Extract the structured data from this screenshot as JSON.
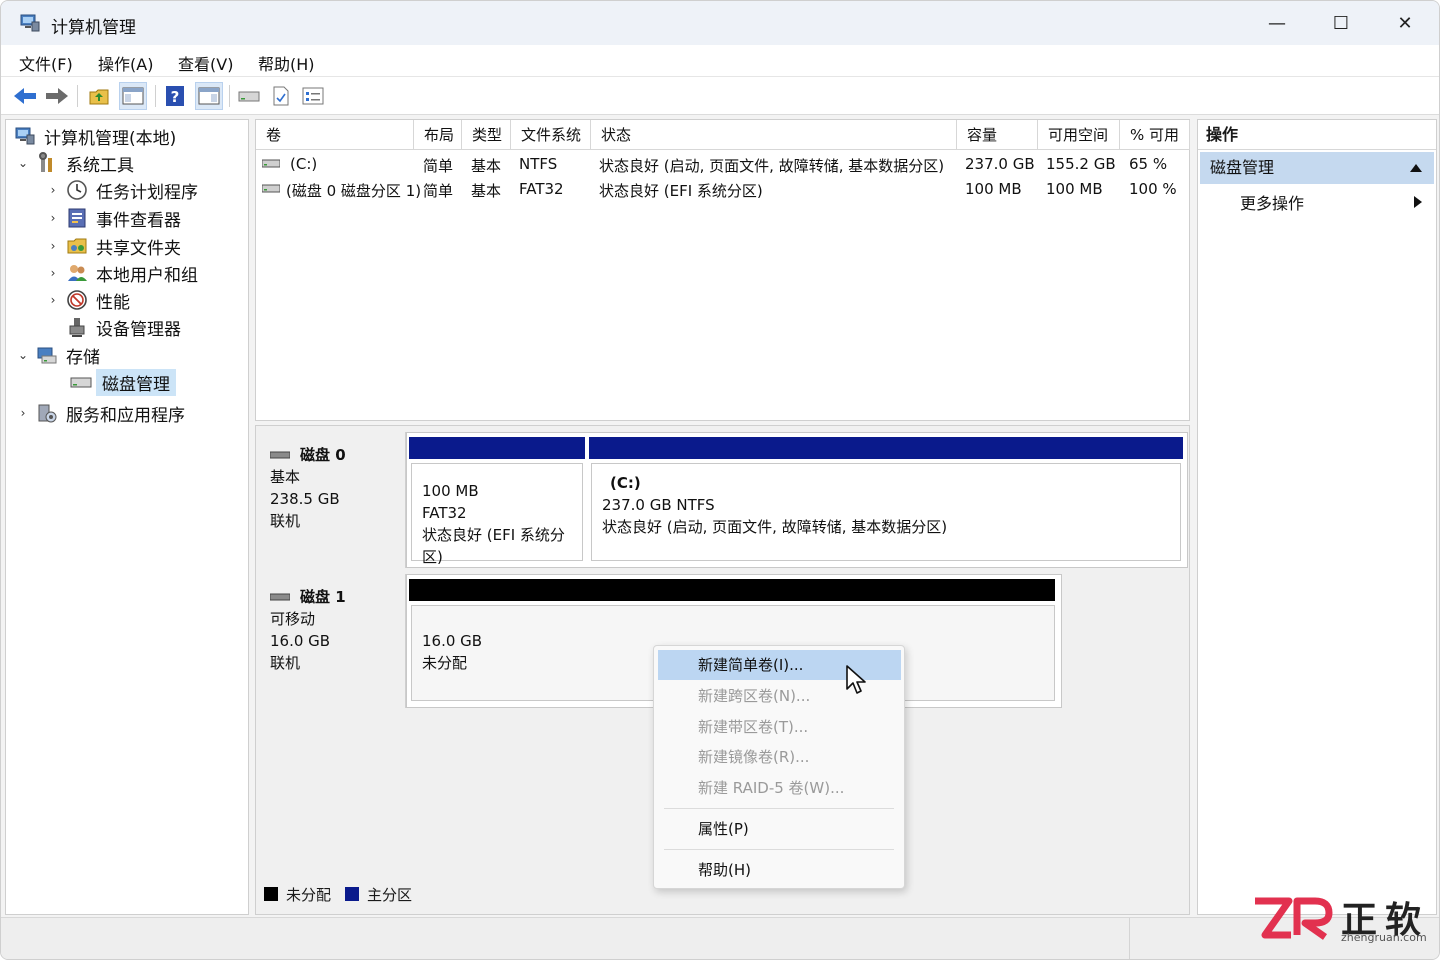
{
  "window": {
    "title": "计算机管理",
    "minimize": "—",
    "maximize": "☐",
    "close": "✕"
  },
  "menu": [
    "文件(F)",
    "操作(A)",
    "查看(V)",
    "帮助(H)"
  ],
  "tree": {
    "root": "计算机管理(本地)",
    "system_tools": "系统工具",
    "task_scheduler": "任务计划程序",
    "event_viewer": "事件查看器",
    "shared_folders": "共享文件夹",
    "local_users": "本地用户和组",
    "performance": "性能",
    "device_manager": "设备管理器",
    "storage": "存储",
    "disk_management": "磁盘管理",
    "services_apps": "服务和应用程序"
  },
  "volumes": {
    "columns": [
      "卷",
      "布局",
      "类型",
      "文件系统",
      "状态",
      "容量",
      "可用空间",
      "% 可用"
    ],
    "rows": [
      [
        "(C:)",
        "简单",
        "基本",
        "NTFS",
        "状态良好 (启动, 页面文件, 故障转储, 基本数据分区)",
        "237.0 GB",
        "155.2 GB",
        "65 %"
      ],
      [
        "(磁盘 0 磁盘分区 1)",
        "简单",
        "基本",
        "FAT32",
        "状态良好 (EFI 系统分区)",
        "100 MB",
        "100 MB",
        "100 %"
      ]
    ]
  },
  "disk0": {
    "name": "磁盘 0",
    "type": "基本",
    "size": "238.5 GB",
    "status": "联机",
    "part1": {
      "size": "100 MB",
      "fs": "FAT32",
      "status": "状态良好 (EFI 系统分区)"
    },
    "part2": {
      "label": "(C:)",
      "size_fs": "237.0 GB NTFS",
      "status": "状态良好 (启动, 页面文件, 故障转储, 基本数据分区)"
    }
  },
  "disk1": {
    "name": "磁盘 1",
    "type": "可移动",
    "size": "16.0 GB",
    "status": "联机",
    "part1": {
      "size": "16.0 GB",
      "status": "未分配"
    }
  },
  "legend": {
    "unallocated": "未分配",
    "primary": "主分区"
  },
  "actions": {
    "title": "操作",
    "group": "磁盘管理",
    "more": "更多操作"
  },
  "context_menu": {
    "new_simple": "新建简单卷(I)...",
    "new_spanned": "新建跨区卷(N)...",
    "new_striped": "新建带区卷(T)...",
    "new_mirrored": "新建镜像卷(R)...",
    "new_raid5": "新建 RAID-5 卷(W)...",
    "properties": "属性(P)",
    "help": "帮助(H)"
  },
  "watermark": {
    "brand_cn": "正软",
    "brand_en": "zhengruan.com"
  },
  "colors": {
    "primary_partition": "#0a1a8c",
    "unallocated": "#000000",
    "selection": "#cce4f7",
    "menu_hover": "#bcd6f2"
  }
}
